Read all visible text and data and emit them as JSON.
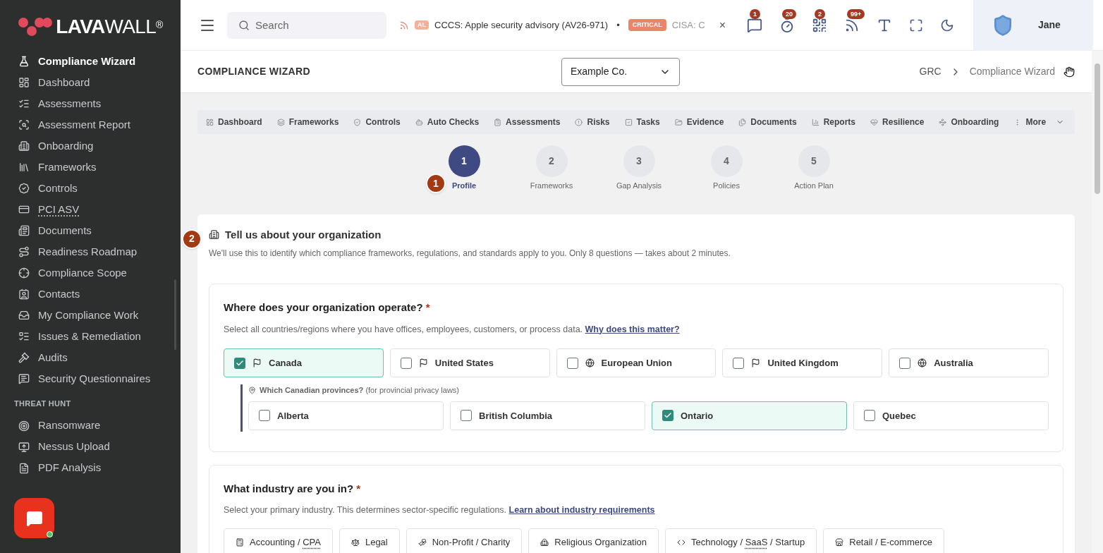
{
  "logo": {
    "bold": "LAVA",
    "light": "WALL",
    "mark": "®"
  },
  "sidebar": {
    "items": [
      {
        "label": "Compliance Wizard",
        "selected": true
      },
      {
        "label": "Dashboard",
        "selected": false
      },
      {
        "label": "Assessments",
        "selected": false
      },
      {
        "label": "Assessment Report",
        "selected": false
      },
      {
        "label": "Onboarding",
        "selected": false
      },
      {
        "label": "Frameworks",
        "selected": false
      },
      {
        "label": "Controls",
        "selected": false
      },
      {
        "label": "PCI ASV",
        "selected": false,
        "abbr": true
      },
      {
        "label": "Documents",
        "selected": false
      },
      {
        "label": "Readiness Roadmap",
        "selected": false
      },
      {
        "label": "Compliance Scope",
        "selected": false
      },
      {
        "label": "Contacts",
        "selected": false
      },
      {
        "label": "My Compliance Work",
        "selected": false
      },
      {
        "label": "Issues & Remediation",
        "selected": false
      },
      {
        "label": "Audits",
        "selected": false
      },
      {
        "label": "Security Questionnaires",
        "selected": false
      }
    ],
    "section": {
      "title": "THREAT HUNT",
      "items": [
        {
          "label": "Ransomware",
          "selected": false
        },
        {
          "label": "Nessus Upload",
          "selected": false
        },
        {
          "label": "PDF Analysis",
          "selected": false
        }
      ]
    }
  },
  "topbar": {
    "search": {
      "placeholder": "Search"
    },
    "ticker": {
      "cut_badge": "AL",
      "headline": "CCCS: Apple security advisory (AV26-971)",
      "separator": "•",
      "badge": "CRITICAL",
      "next": "CISA: C",
      "close": "×"
    },
    "badges": [
      "1",
      "20",
      "2",
      "99+"
    ],
    "user": "Jane"
  },
  "page": {
    "title": "COMPLIANCE WIZARD",
    "company": "Example Co.",
    "breadcrumb": [
      "GRC",
      "Compliance Wizard"
    ]
  },
  "subnav": [
    "Dashboard",
    "Frameworks",
    "Controls",
    "Auto Checks",
    "Assessments",
    "Risks",
    "Tasks",
    "Evidence",
    "Documents",
    "Reports",
    "Resilience",
    "Onboarding",
    "More"
  ],
  "steps": [
    {
      "number": "1",
      "label": "Profile",
      "selected": true
    },
    {
      "number": "2",
      "label": "Frameworks",
      "selected": false
    },
    {
      "number": "3",
      "label": "Gap Analysis",
      "selected": false
    },
    {
      "number": "4",
      "label": "Policies",
      "selected": false
    },
    {
      "number": "5",
      "label": "Action Plan",
      "selected": false
    }
  ],
  "markers": [
    "1",
    "2"
  ],
  "section": {
    "title": "Tell us about your organization",
    "description": "We'll use this to identify which compliance frameworks, regulations, and standards apply to you. Only 8 questions — takes about 2 minutes."
  },
  "q1": {
    "title": "Where does your organization operate?",
    "required": "*",
    "hint": "Select all countries/regions where you have offices, employees, customers, or process data.",
    "link": "Why does this matter?",
    "options": [
      {
        "label": "Canada",
        "checked": true,
        "kind": "flag"
      },
      {
        "label": "United States",
        "checked": false,
        "kind": "flag"
      },
      {
        "label": "European Union",
        "checked": false,
        "kind": "globe"
      },
      {
        "label": "United Kingdom",
        "checked": false,
        "kind": "flag"
      },
      {
        "label": "Australia",
        "checked": false,
        "kind": "globe"
      }
    ],
    "sub": {
      "title": "Which Canadian provinces?",
      "note": "(for provincial privacy laws)",
      "options": [
        {
          "label": "Alberta",
          "checked": false
        },
        {
          "label": "British Columbia",
          "checked": false
        },
        {
          "label": "Ontario",
          "checked": true
        },
        {
          "label": "Quebec",
          "checked": false
        }
      ]
    }
  },
  "q2": {
    "title": "What industry are you in?",
    "required": "*",
    "hint": "Select your primary industry. This determines sector-specific regulations.",
    "link": "Learn about industry requirements",
    "options": [
      {
        "parts": [
          {
            "text": "Accounting / "
          },
          {
            "text": "CPA",
            "abbr": true
          }
        ]
      },
      {
        "parts": [
          {
            "text": "Legal"
          }
        ]
      },
      {
        "parts": [
          {
            "text": "Non-Profit / Charity"
          }
        ]
      },
      {
        "parts": [
          {
            "text": "Religious Organization"
          }
        ]
      },
      {
        "parts": [
          {
            "text": "Technology / "
          },
          {
            "text": "SaaS",
            "abbr": true
          },
          {
            "text": " / Startup"
          }
        ]
      },
      {
        "parts": [
          {
            "text": "Retail / E-commerce"
          }
        ]
      }
    ]
  }
}
